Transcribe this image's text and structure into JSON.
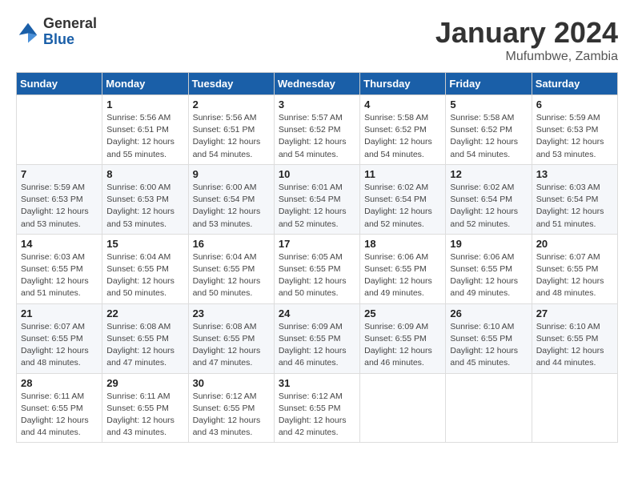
{
  "logo": {
    "general": "General",
    "blue": "Blue"
  },
  "title": "January 2024",
  "location": "Mufumbwe, Zambia",
  "days_of_week": [
    "Sunday",
    "Monday",
    "Tuesday",
    "Wednesday",
    "Thursday",
    "Friday",
    "Saturday"
  ],
  "weeks": [
    [
      {
        "day": "",
        "info": ""
      },
      {
        "day": "1",
        "info": "Sunrise: 5:56 AM\nSunset: 6:51 PM\nDaylight: 12 hours\nand 55 minutes."
      },
      {
        "day": "2",
        "info": "Sunrise: 5:56 AM\nSunset: 6:51 PM\nDaylight: 12 hours\nand 54 minutes."
      },
      {
        "day": "3",
        "info": "Sunrise: 5:57 AM\nSunset: 6:52 PM\nDaylight: 12 hours\nand 54 minutes."
      },
      {
        "day": "4",
        "info": "Sunrise: 5:58 AM\nSunset: 6:52 PM\nDaylight: 12 hours\nand 54 minutes."
      },
      {
        "day": "5",
        "info": "Sunrise: 5:58 AM\nSunset: 6:52 PM\nDaylight: 12 hours\nand 54 minutes."
      },
      {
        "day": "6",
        "info": "Sunrise: 5:59 AM\nSunset: 6:53 PM\nDaylight: 12 hours\nand 53 minutes."
      }
    ],
    [
      {
        "day": "7",
        "info": "Sunrise: 5:59 AM\nSunset: 6:53 PM\nDaylight: 12 hours\nand 53 minutes."
      },
      {
        "day": "8",
        "info": "Sunrise: 6:00 AM\nSunset: 6:53 PM\nDaylight: 12 hours\nand 53 minutes."
      },
      {
        "day": "9",
        "info": "Sunrise: 6:00 AM\nSunset: 6:54 PM\nDaylight: 12 hours\nand 53 minutes."
      },
      {
        "day": "10",
        "info": "Sunrise: 6:01 AM\nSunset: 6:54 PM\nDaylight: 12 hours\nand 52 minutes."
      },
      {
        "day": "11",
        "info": "Sunrise: 6:02 AM\nSunset: 6:54 PM\nDaylight: 12 hours\nand 52 minutes."
      },
      {
        "day": "12",
        "info": "Sunrise: 6:02 AM\nSunset: 6:54 PM\nDaylight: 12 hours\nand 52 minutes."
      },
      {
        "day": "13",
        "info": "Sunrise: 6:03 AM\nSunset: 6:54 PM\nDaylight: 12 hours\nand 51 minutes."
      }
    ],
    [
      {
        "day": "14",
        "info": "Sunrise: 6:03 AM\nSunset: 6:55 PM\nDaylight: 12 hours\nand 51 minutes."
      },
      {
        "day": "15",
        "info": "Sunrise: 6:04 AM\nSunset: 6:55 PM\nDaylight: 12 hours\nand 50 minutes."
      },
      {
        "day": "16",
        "info": "Sunrise: 6:04 AM\nSunset: 6:55 PM\nDaylight: 12 hours\nand 50 minutes."
      },
      {
        "day": "17",
        "info": "Sunrise: 6:05 AM\nSunset: 6:55 PM\nDaylight: 12 hours\nand 50 minutes."
      },
      {
        "day": "18",
        "info": "Sunrise: 6:06 AM\nSunset: 6:55 PM\nDaylight: 12 hours\nand 49 minutes."
      },
      {
        "day": "19",
        "info": "Sunrise: 6:06 AM\nSunset: 6:55 PM\nDaylight: 12 hours\nand 49 minutes."
      },
      {
        "day": "20",
        "info": "Sunrise: 6:07 AM\nSunset: 6:55 PM\nDaylight: 12 hours\nand 48 minutes."
      }
    ],
    [
      {
        "day": "21",
        "info": "Sunrise: 6:07 AM\nSunset: 6:55 PM\nDaylight: 12 hours\nand 48 minutes."
      },
      {
        "day": "22",
        "info": "Sunrise: 6:08 AM\nSunset: 6:55 PM\nDaylight: 12 hours\nand 47 minutes."
      },
      {
        "day": "23",
        "info": "Sunrise: 6:08 AM\nSunset: 6:55 PM\nDaylight: 12 hours\nand 47 minutes."
      },
      {
        "day": "24",
        "info": "Sunrise: 6:09 AM\nSunset: 6:55 PM\nDaylight: 12 hours\nand 46 minutes."
      },
      {
        "day": "25",
        "info": "Sunrise: 6:09 AM\nSunset: 6:55 PM\nDaylight: 12 hours\nand 46 minutes."
      },
      {
        "day": "26",
        "info": "Sunrise: 6:10 AM\nSunset: 6:55 PM\nDaylight: 12 hours\nand 45 minutes."
      },
      {
        "day": "27",
        "info": "Sunrise: 6:10 AM\nSunset: 6:55 PM\nDaylight: 12 hours\nand 44 minutes."
      }
    ],
    [
      {
        "day": "28",
        "info": "Sunrise: 6:11 AM\nSunset: 6:55 PM\nDaylight: 12 hours\nand 44 minutes."
      },
      {
        "day": "29",
        "info": "Sunrise: 6:11 AM\nSunset: 6:55 PM\nDaylight: 12 hours\nand 43 minutes."
      },
      {
        "day": "30",
        "info": "Sunrise: 6:12 AM\nSunset: 6:55 PM\nDaylight: 12 hours\nand 43 minutes."
      },
      {
        "day": "31",
        "info": "Sunrise: 6:12 AM\nSunset: 6:55 PM\nDaylight: 12 hours\nand 42 minutes."
      },
      {
        "day": "",
        "info": ""
      },
      {
        "day": "",
        "info": ""
      },
      {
        "day": "",
        "info": ""
      }
    ]
  ]
}
